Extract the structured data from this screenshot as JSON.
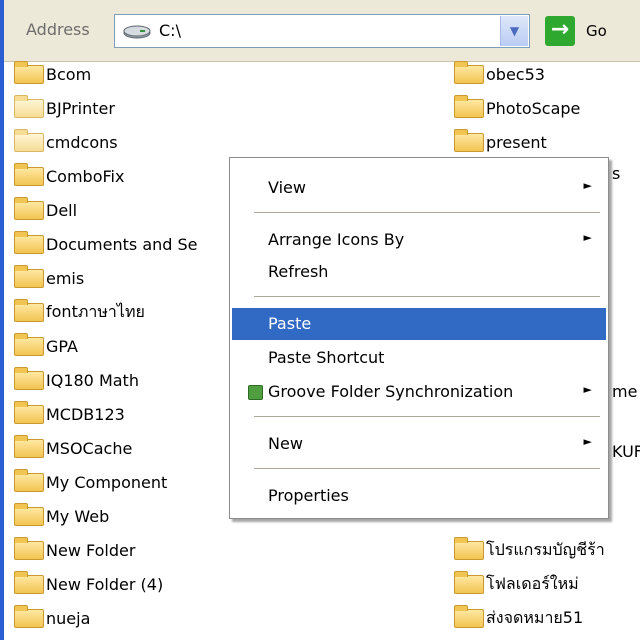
{
  "address_bar": {
    "label": "Address",
    "value": "C:\\",
    "go_label": "Go"
  },
  "folders_left": [
    "Bcom",
    "BJPrinter",
    "cmdcons",
    "ComboFix",
    "Dell",
    "Documents and Se",
    "emis",
    "fontภาษาไทย",
    "GPA",
    "IQ180 Math",
    "MCDB123",
    "MSOCache",
    "My Component",
    "My Web",
    "New Folder",
    "New Folder (4)",
    "nueja"
  ],
  "folders_right": [
    "obec53",
    "PhotoScape",
    "present",
    "โปรแกรมบัญชีร้า",
    "โฟลเดอร์ใหม่",
    "ส่งจดหมาย51"
  ],
  "right_partial_text": [
    "s",
    "me",
    "KUF"
  ],
  "context_menu": {
    "items": [
      {
        "label": "View",
        "submenu": true
      },
      {
        "label": "Arrange Icons By",
        "submenu": true
      },
      {
        "label": "Refresh",
        "submenu": false
      },
      {
        "label": "Paste",
        "submenu": false,
        "highlighted": true
      },
      {
        "label": "Paste Shortcut",
        "submenu": false
      },
      {
        "label": "Groove Folder Synchronization",
        "submenu": true,
        "icon": "groove-icon"
      },
      {
        "label": "New",
        "submenu": true
      },
      {
        "label": "Properties",
        "submenu": false
      }
    ],
    "submenu_arrow": "►"
  },
  "colors": {
    "highlight": "#316ac5",
    "folder": "#f2c452",
    "toolbar": "#ece9d8"
  }
}
